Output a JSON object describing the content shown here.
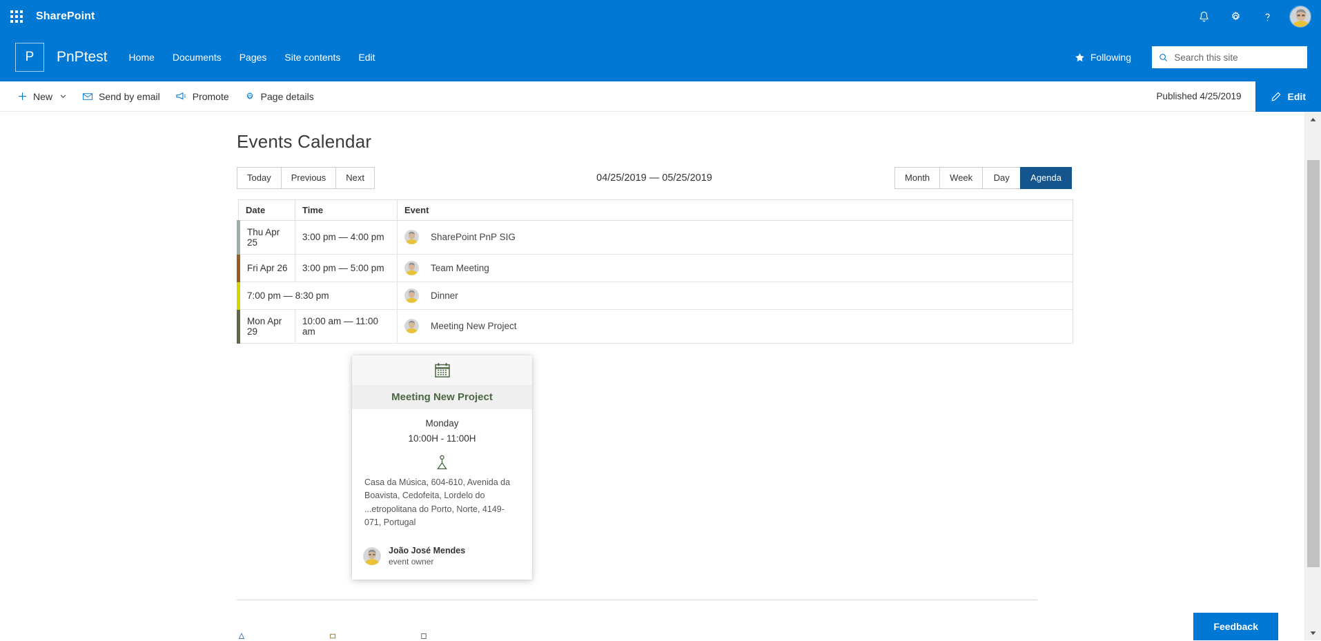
{
  "suite": {
    "brand": "SharePoint",
    "waffle_icon": "app-launcher-waffle-icon",
    "notifications_icon": "bell-icon",
    "settings_icon": "gear-icon",
    "help_icon": "question-mark-icon",
    "avatar_alt": "user-avatar"
  },
  "site": {
    "logo_letter": "P",
    "title": "PnPtest",
    "nav": [
      {
        "label": "Home"
      },
      {
        "label": "Documents"
      },
      {
        "label": "Pages"
      },
      {
        "label": "Site contents"
      },
      {
        "label": "Edit"
      }
    ],
    "following_label": "Following",
    "following_icon": "star-icon",
    "search_placeholder": "Search this site",
    "search_value": "",
    "search_icon": "search-icon"
  },
  "command_bar": {
    "items": [
      {
        "label": "New",
        "icon": "plus-icon",
        "has_chevron": true
      },
      {
        "label": "Send by email",
        "icon": "mail-icon",
        "has_chevron": false
      },
      {
        "label": "Promote",
        "icon": "megaphone-icon",
        "has_chevron": false
      },
      {
        "label": "Page details",
        "icon": "gear-icon",
        "has_chevron": false
      }
    ],
    "published_status": "Published 4/25/2019",
    "edit_label": "Edit",
    "edit_icon": "pencil-icon"
  },
  "calendar": {
    "page_title": "Events Calendar",
    "nav_buttons": [
      {
        "label": "Today",
        "active": false
      },
      {
        "label": "Previous",
        "active": false
      },
      {
        "label": "Next",
        "active": false
      }
    ],
    "date_range": "04/25/2019 — 05/25/2019",
    "view_buttons": [
      {
        "label": "Month",
        "active": false
      },
      {
        "label": "Week",
        "active": false
      },
      {
        "label": "Day",
        "active": false
      },
      {
        "label": "Agenda",
        "active": true
      }
    ],
    "columns": [
      "Date",
      "Time",
      "Event"
    ],
    "events": [
      {
        "date": "Thu Apr 25",
        "time": "3:00 pm — 4:00 pm",
        "title": "SharePoint PnP SIG",
        "accent": "#9bb0a5",
        "show_date": true
      },
      {
        "date": "Fri Apr 26",
        "time": "3:00 pm — 5:00 pm",
        "title": "Team Meeting",
        "accent": "#9a5c26",
        "show_date": true
      },
      {
        "date": "",
        "time": "7:00 pm — 8:30 pm",
        "title": "Dinner",
        "accent": "#d4d400",
        "show_date": false
      },
      {
        "date": "Mon Apr 29",
        "time": "10:00 am — 11:00 am",
        "title": "Meeting New Project",
        "accent": "#5b6b4a",
        "show_date": true
      }
    ]
  },
  "event_card": {
    "header_icon": "calendar-icon",
    "title": "Meeting New Project",
    "day": "Monday",
    "time": "10:00H - 11:00H",
    "location_icon": "location-pin-icon",
    "address": "Casa da Música, 604-610, Avenida da Boavista, Cedofeita, Lordelo do ...etropolitana do Porto, Norte, 4149-071, Portugal",
    "owner_name": "João José Mendes",
    "owner_role": "event owner",
    "accent_color": "#4a6741"
  },
  "feedback": {
    "label": "Feedback"
  },
  "scrollbar": {
    "up_icon": "chevron-up-icon",
    "down_icon": "chevron-down-icon"
  }
}
